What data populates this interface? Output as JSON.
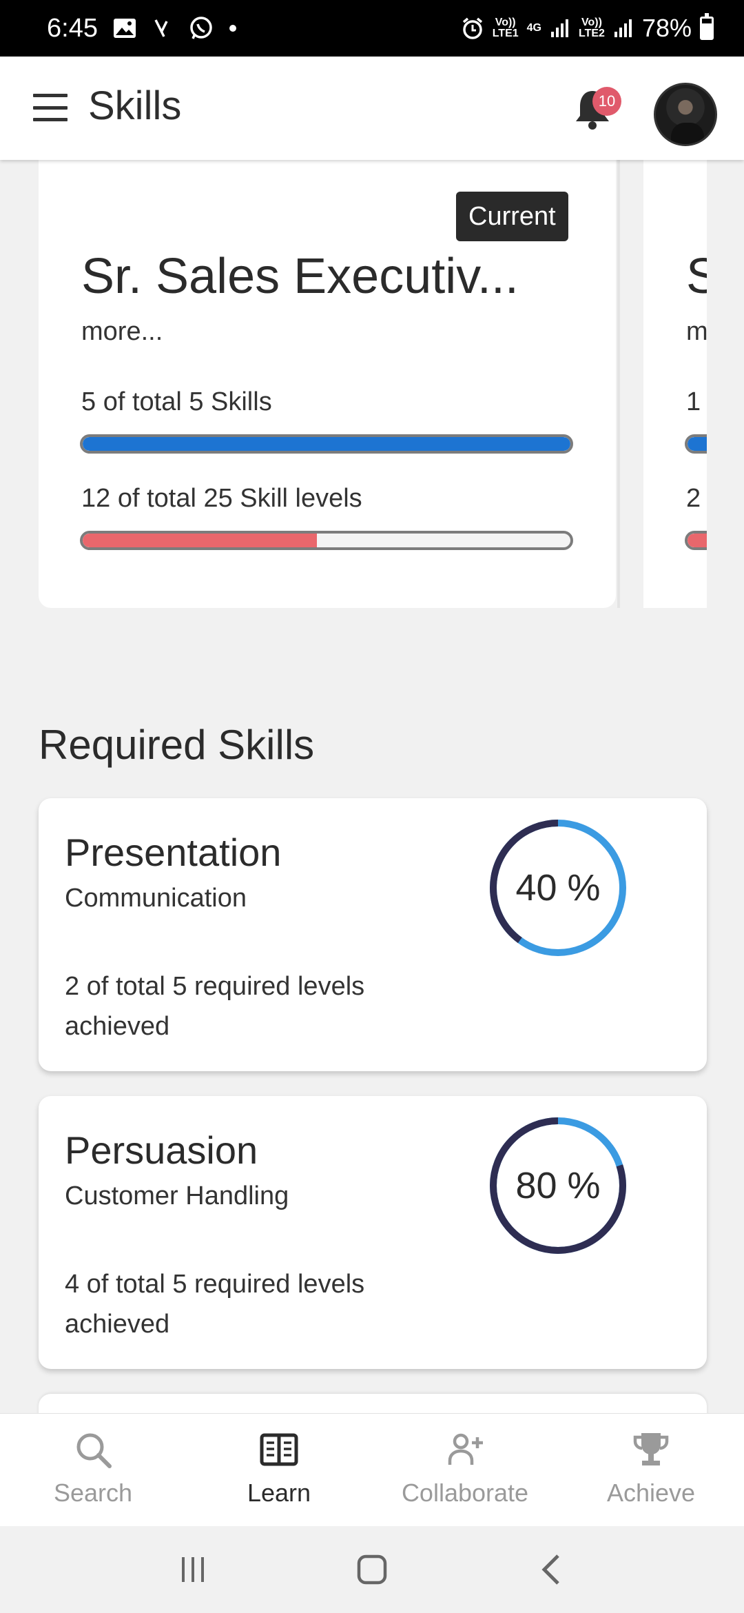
{
  "status_bar": {
    "time": "6:45",
    "battery": "78%",
    "net_4g": "4G",
    "volte1": "Vo))",
    "lte1": "LTE1",
    "volte2": "Vo))",
    "lte2": "LTE2"
  },
  "app_bar": {
    "title": "Skills",
    "notification_count": "10"
  },
  "role_cards": [
    {
      "tag": "Current",
      "title": "Sr. Sales Executiv...",
      "more": "more...",
      "skills_label": "5 of total 5 Skills",
      "skills_progress": 1.0,
      "levels_label": "12 of total 25 Skill levels",
      "levels_progress": 0.48
    },
    {
      "title": "S",
      "more": "m",
      "skills_label": "1",
      "levels_label": "2"
    }
  ],
  "required_skills": {
    "title": "Required Skills",
    "items": [
      {
        "name": "Presentation",
        "category": "Communication",
        "achieved": "2 of total 5 required levels achieved",
        "percent_label": "40 %",
        "percent": 40
      },
      {
        "name": "Persuasion",
        "category": "Customer Handling",
        "achieved": "4 of total 5 required levels achieved",
        "percent_label": "80 %",
        "percent": 80
      }
    ]
  },
  "bottom_nav": {
    "items": [
      {
        "label": "Search",
        "icon": "search-icon",
        "active": false
      },
      {
        "label": "Learn",
        "icon": "book-icon",
        "active": true
      },
      {
        "label": "Collaborate",
        "icon": "add-person-icon",
        "active": false
      },
      {
        "label": "Achieve",
        "icon": "trophy-icon",
        "active": false
      }
    ]
  },
  "colors": {
    "skills_bar": "#1d74d2",
    "levels_bar": "#e9676c",
    "ring_progress": "#2e2d52",
    "ring_remaining": "#3b9be2",
    "badge": "#e05a6b"
  }
}
